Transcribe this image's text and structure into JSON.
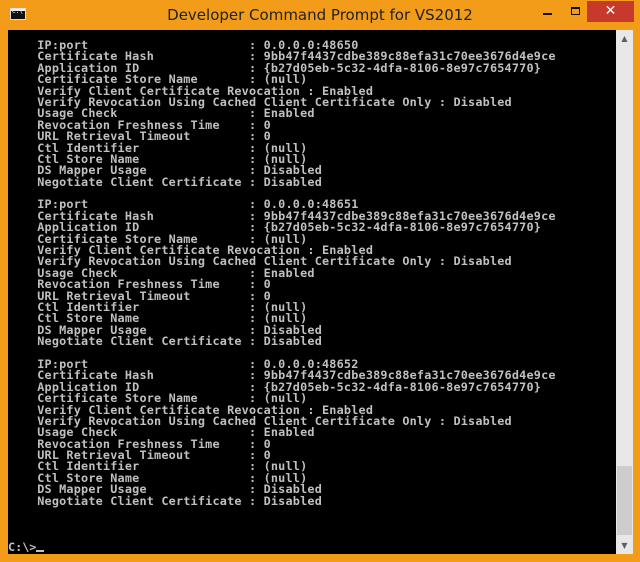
{
  "window": {
    "title": "Developer Command Prompt for VS2012",
    "buttons": {
      "minimize": "–",
      "maximize": "□",
      "close": "✕"
    }
  },
  "console": {
    "lines": [
      "    IP:port                      : 0.0.0.0:48650",
      "    Certificate Hash             : 9bb47f4437cdbe389c88efa31c70ee3676d4e9ce",
      "    Application ID               : {b27d05eb-5c32-4dfa-8106-8e97c7654770}",
      "    Certificate Store Name       : (null)",
      "    Verify Client Certificate Revocation : Enabled",
      "    Verify Revocation Using Cached Client Certificate Only : Disabled",
      "    Usage Check                  : Enabled",
      "    Revocation Freshness Time    : 0",
      "    URL Retrieval Timeout        : 0",
      "    Ctl Identifier               : (null)",
      "    Ctl Store Name               : (null)",
      "    DS Mapper Usage              : Disabled",
      "    Negotiate Client Certificate : Disabled",
      "",
      "    IP:port                      : 0.0.0.0:48651",
      "    Certificate Hash             : 9bb47f4437cdbe389c88efa31c70ee3676d4e9ce",
      "    Application ID               : {b27d05eb-5c32-4dfa-8106-8e97c7654770}",
      "    Certificate Store Name       : (null)",
      "    Verify Client Certificate Revocation : Enabled",
      "    Verify Revocation Using Cached Client Certificate Only : Disabled",
      "    Usage Check                  : Enabled",
      "    Revocation Freshness Time    : 0",
      "    URL Retrieval Timeout        : 0",
      "    Ctl Identifier               : (null)",
      "    Ctl Store Name               : (null)",
      "    DS Mapper Usage              : Disabled",
      "    Negotiate Client Certificate : Disabled",
      "",
      "    IP:port                      : 0.0.0.0:48652",
      "    Certificate Hash             : 9bb47f4437cdbe389c88efa31c70ee3676d4e9ce",
      "    Application ID               : {b27d05eb-5c32-4dfa-8106-8e97c7654770}",
      "    Certificate Store Name       : (null)",
      "    Verify Client Certificate Revocation : Enabled",
      "    Verify Revocation Using Cached Client Certificate Only : Disabled",
      "    Usage Check                  : Enabled",
      "    Revocation Freshness Time    : 0",
      "    URL Retrieval Timeout        : 0",
      "    Ctl Identifier               : (null)",
      "    Ctl Store Name               : (null)",
      "    DS Mapper Usage              : Disabled",
      "    Negotiate Client Certificate : Disabled"
    ],
    "prompt": "C:\\>"
  },
  "scrollbar": {
    "up_icon": "▲",
    "down_icon": "▼"
  },
  "colors": {
    "frame": "#f39c19",
    "close": "#c7392b",
    "console_bg": "#000000",
    "console_text": "#c0c0c0"
  }
}
